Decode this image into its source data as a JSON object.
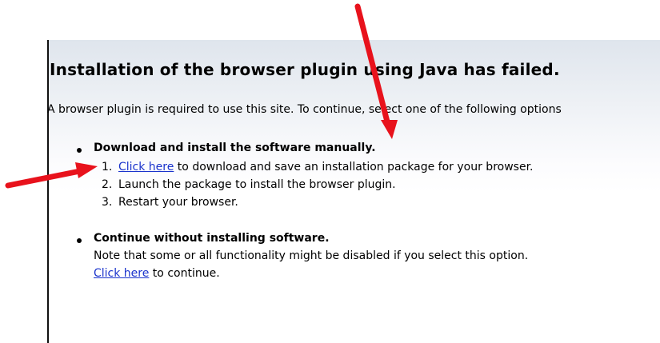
{
  "page": {
    "title": "Installation of the browser plugin using Java has failed.",
    "intro": "A browser plugin is required to use this site. To continue, select one of the following options"
  },
  "option_manual": {
    "heading": "Download and install the software manually.",
    "steps": [
      {
        "num": "1.",
        "link": "Click here",
        "text": " to download and save an installation package for your browser."
      },
      {
        "num": "2.",
        "text": "Launch the package to install the browser plugin."
      },
      {
        "num": "3.",
        "text": "Restart your browser."
      }
    ]
  },
  "option_continue": {
    "heading": "Continue without installing software.",
    "note": "Note that some or all functionality might be disabled if you select this option.",
    "link": "Click here",
    "link_suffix": " to continue."
  },
  "colors": {
    "link": "#1a33cc",
    "annotation_arrow": "#e8121c"
  },
  "icons": [
    "arrow-annotation-icon",
    "bullet-icon"
  ]
}
